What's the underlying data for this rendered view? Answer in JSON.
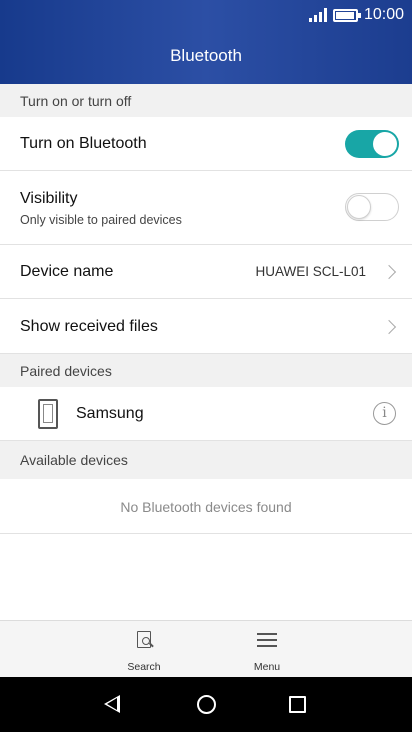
{
  "status_bar": {
    "time": "10:00",
    "icons": [
      "signal-icon",
      "battery-icon"
    ]
  },
  "header": {
    "title": "Bluetooth"
  },
  "sections": {
    "toggle_section": "Turn on or turn off",
    "paired": "Paired devices",
    "available": "Available devices"
  },
  "settings": {
    "bluetooth": {
      "label": "Turn on Bluetooth",
      "state": "on"
    },
    "visibility": {
      "label": "Visibility",
      "sublabel": "Only visible to paired devices",
      "state": "off"
    },
    "device_name": {
      "label": "Device name",
      "value": "HUAWEI SCL-L01"
    },
    "received_files": {
      "label": "Show received files"
    }
  },
  "paired_devices": [
    {
      "name": "Samsung",
      "icon": "phone-icon"
    }
  ],
  "available_devices": {
    "empty_text": "No Bluetooth devices found"
  },
  "bottom_bar": {
    "search_label": "Search",
    "menu_label": "Menu"
  },
  "colors": {
    "header": "#1f4296",
    "accent": "#18a6a6",
    "section_bg": "#f1f1f1"
  }
}
